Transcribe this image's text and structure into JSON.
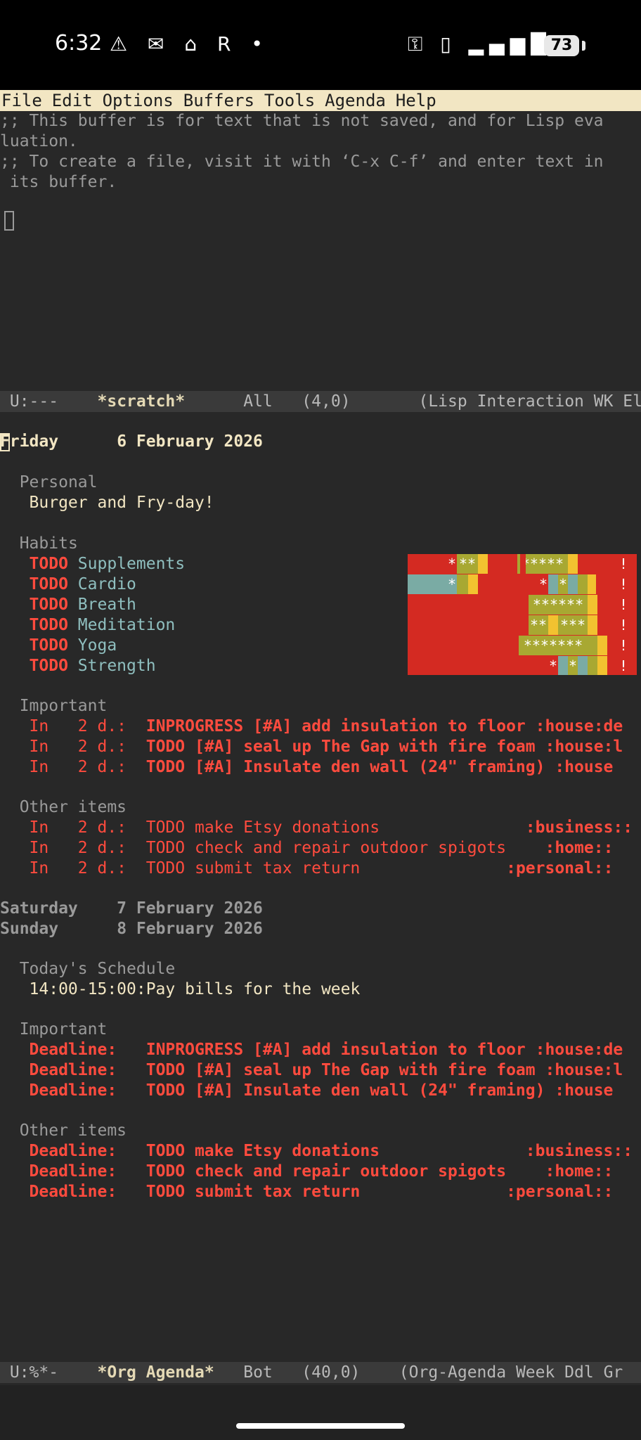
{
  "status_bar": {
    "time": "6:32",
    "notification_icons": "⚠ ✉ ⌂ R •",
    "system_icons": "⚿ ▯ ▂▄▆█ ≋",
    "battery": "73"
  },
  "menu": [
    "File",
    "Edit",
    "Options",
    "Buffers",
    "Tools",
    "Agenda",
    "Help"
  ],
  "scratch": {
    "lines": [
      ";; This buffer is for text that is not saved, and for Lisp eva",
      "luation.",
      ";; To create a file, visit it with ‘C-x C-f’ and enter text in",
      " its buffer."
    ],
    "modeline": {
      "state": "U:---",
      "buffer": "*scratch*",
      "position": "All   (4,0)",
      "modes": "(Lisp Interaction WK El"
    }
  },
  "agenda": {
    "day1": {
      "weekday": "Friday",
      "date": "6 February 2026"
    },
    "personal": {
      "heading": "Personal",
      "items": [
        "Burger and Fry-day!"
      ]
    },
    "habits": {
      "heading": "Habits",
      "keyword": "TODO",
      "items": [
        "Supplements",
        "Cardio",
        "Breath",
        "Meditation",
        "Yoga",
        "Strength"
      ]
    },
    "important": {
      "heading": "Important",
      "items": [
        {
          "when": "In   2 d.:",
          "text": "INPROGRESS [#A] add insulation to floor :house:de"
        },
        {
          "when": "In   2 d.:",
          "text": "TODO [#A] seal up The Gap with fire foam :house:l"
        },
        {
          "when": "In   2 d.:",
          "text": "TODO [#A] Insulate den wall (24\" framing) :house"
        }
      ]
    },
    "other": {
      "heading": "Other items",
      "items": [
        {
          "when": "In   2 d.:",
          "text": "TODO make Etsy donations",
          "tag": ":business::"
        },
        {
          "when": "In   2 d.:",
          "text": "TODO check and repair outdoor spigots",
          "tag": ":home::"
        },
        {
          "when": "In   2 d.:",
          "text": "TODO submit tax return",
          "tag": ":personal::"
        }
      ]
    },
    "day2": {
      "weekday": "Saturday",
      "date": "7 February 2026"
    },
    "day3": {
      "weekday": "Sunday",
      "date": "8 February 2026"
    },
    "schedule": {
      "heading": "Today's Schedule",
      "items": [
        "14:00-15:00:Pay bills for the week"
      ]
    },
    "important2": {
      "heading": "Important",
      "items": [
        {
          "when": "Deadline:",
          "text": "INPROGRESS [#A] add insulation to floor :house:de"
        },
        {
          "when": "Deadline:",
          "text": "TODO [#A] seal up The Gap with fire foam :house:l"
        },
        {
          "when": "Deadline:",
          "text": "TODO [#A] Insulate den wall (24\" framing) :house"
        }
      ]
    },
    "other2": {
      "heading": "Other items",
      "items": [
        {
          "when": "Deadline:",
          "text": "TODO make Etsy donations",
          "tag": ":business::"
        },
        {
          "when": "Deadline:",
          "text": "TODO check and repair outdoor spigots",
          "tag": ":home::"
        },
        {
          "when": "Deadline:",
          "text": "TODO submit tax return",
          "tag": ":personal::"
        }
      ]
    },
    "modeline": {
      "state": "U:%*-",
      "buffer": "*Org Agenda*",
      "position": "Bot   (40,0)",
      "modes": "(Org-Agenda Week Ddl Gr"
    }
  },
  "colors": {
    "background": "#282828",
    "menu_bg": "#f2e6c3",
    "todo_red": "#ff4b3e",
    "habit_cyan": "#8fbfbf",
    "habit_red": "#d42a22",
    "habit_olive": "#a8a832",
    "habit_yellow": "#f2c230",
    "habit_teal": "#7aaba4"
  }
}
